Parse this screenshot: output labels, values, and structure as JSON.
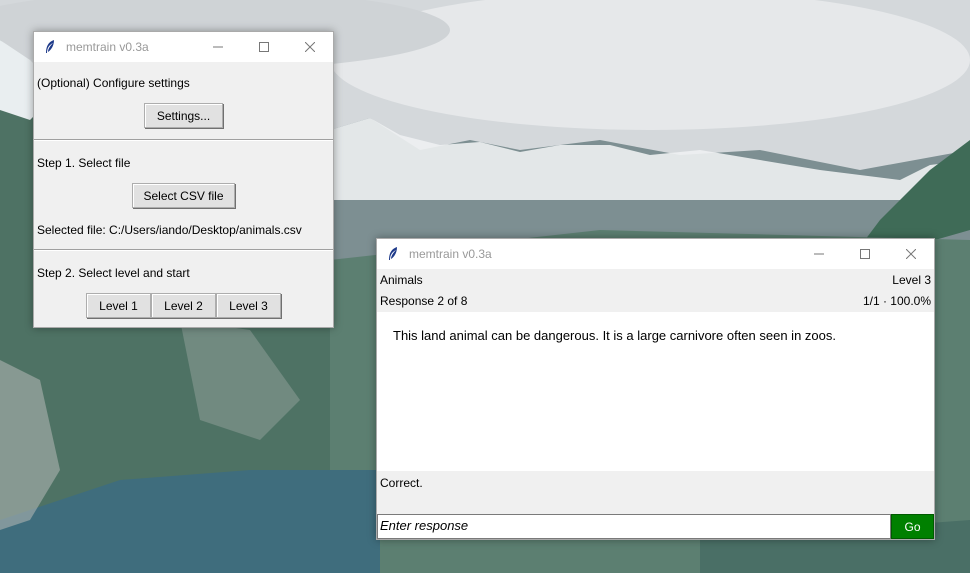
{
  "settings_window": {
    "title": "memtrain v0.3a",
    "configure_label": "(Optional) Configure settings",
    "settings_button": "Settings...",
    "step1_label": "Step 1. Select file",
    "select_csv_button": "Select CSV file",
    "selected_file_label": "Selected file: C:/Users/iando/Desktop/animals.csv",
    "step2_label": "Step 2. Select level and start",
    "level_buttons": [
      "Level 1",
      "Level 2",
      "Level 3"
    ]
  },
  "trainer_window": {
    "title": "memtrain v0.3a",
    "category": "Animals",
    "level": "Level 3",
    "response_counter": "Response 2 of 8",
    "score": "1/1 · 100.0%",
    "prompt_text": "This land animal can be dangerous. It is a large carnivore often seen in zoos.",
    "feedback": "Correct.",
    "response_placeholder": "Enter response",
    "go_button": "Go"
  },
  "icons": {
    "app": "feather-icon",
    "minimize": "minimize-icon",
    "maximize": "maximize-icon",
    "close": "close-icon"
  },
  "colors": {
    "go_button": "#008000"
  }
}
